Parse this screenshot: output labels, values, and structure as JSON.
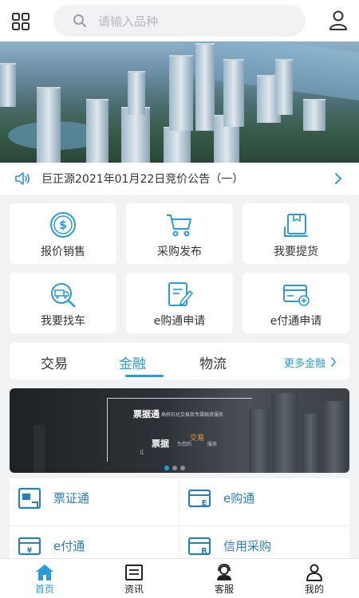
{
  "search": {
    "placeholder": "请输入品种"
  },
  "notice": {
    "text": "巨正源2021年01月22日竞价公告（一）"
  },
  "quick_actions": [
    {
      "label": "报价销售",
      "icon": "dollar-coin-icon"
    },
    {
      "label": "采购发布",
      "icon": "shopping-cart-icon"
    },
    {
      "label": "我要提货",
      "icon": "package-box-icon"
    },
    {
      "label": "我要找车",
      "icon": "truck-search-icon"
    },
    {
      "label": "e购通申请",
      "icon": "document-edit-icon"
    },
    {
      "label": "e付通申请",
      "icon": "card-add-icon"
    }
  ],
  "tabs": {
    "items": [
      "交易",
      "金融",
      "物流"
    ],
    "active": "金融",
    "more_label": "更多金融"
  },
  "promo": {
    "title1": "票据通",
    "subtitle1": "高桥石化交易商专属融资服务",
    "title2": "票据",
    "subtitle2": "为您的",
    "highlight": "交易",
    "highlight_suffix": "服务",
    "prefix_small": "让",
    "page_count": 3,
    "active_page": 1
  },
  "services": [
    {
      "label": "票证通",
      "icon": "ticket-icon"
    },
    {
      "label": "e购通",
      "icon": "e-purchase-icon"
    },
    {
      "label": "e付通",
      "icon": "e-pay-icon"
    },
    {
      "label": "信用采购",
      "icon": "credit-purchase-icon"
    }
  ],
  "bottom_nav": [
    {
      "label": "首页",
      "icon": "home-icon",
      "active": true
    },
    {
      "label": "资讯",
      "icon": "news-icon",
      "active": false
    },
    {
      "label": "客服",
      "icon": "customer-service-icon",
      "active": false
    },
    {
      "label": "我的",
      "icon": "profile-icon",
      "active": false
    }
  ],
  "colors": {
    "accent": "#2a9bd3",
    "service_text": "#2a7fb5",
    "highlight": "#f0a030"
  }
}
